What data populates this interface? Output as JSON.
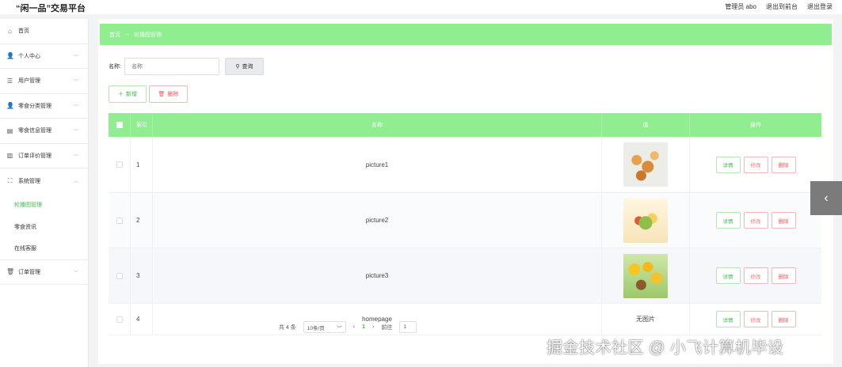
{
  "header": {
    "brand": "“闲一品”交易平台",
    "admin": "管理员 abo",
    "to_front": "退出到前台",
    "logout": "退出登录"
  },
  "sidebar": {
    "items": [
      {
        "label": "首页",
        "icon": "home-icon",
        "glyph": "⌂"
      },
      {
        "label": "个人中心",
        "icon": "user-icon",
        "glyph": "👤"
      },
      {
        "label": "用户管理",
        "icon": "list-icon",
        "glyph": "☰"
      },
      {
        "label": "零食分类管理",
        "icon": "person-icon",
        "glyph": "👤"
      },
      {
        "label": "零食信息管理",
        "icon": "folder-icon",
        "glyph": "▤"
      },
      {
        "label": "订单评价管理",
        "icon": "chart-icon",
        "glyph": "▥"
      },
      {
        "label": "系统管理",
        "icon": "expand-icon",
        "glyph": "⛶"
      }
    ],
    "sub_items": [
      "轮播图管理",
      "零食资讯",
      "在线客服"
    ],
    "last_item": {
      "label": "订单管理",
      "icon": "trash-icon",
      "glyph": "🗑"
    }
  },
  "breadcrumb": {
    "home": "首页",
    "arrow": "→",
    "current": "轮播图管理"
  },
  "search": {
    "label": "名称",
    "placeholder": "名称",
    "button": "查询"
  },
  "actions": {
    "add": "新增",
    "delete": "删除"
  },
  "table": {
    "columns": [
      "索引",
      "名称",
      "值",
      "操作"
    ],
    "rows": [
      {
        "index": "1",
        "name": "picture1",
        "image": "thumb1"
      },
      {
        "index": "2",
        "name": "picture2",
        "image": "thumb2"
      },
      {
        "index": "3",
        "name": "picture3",
        "image": "thumb3"
      },
      {
        "index": "4",
        "name": "homepage",
        "image_text": "无图片"
      }
    ],
    "op_detail": "详情",
    "op_edit": "修改",
    "op_delete": "删除"
  },
  "pager": {
    "total": "共 4 条",
    "page_size": "10条/页",
    "current": "1",
    "goto_label": "前往",
    "goto_value": "1"
  },
  "watermark": "掘金技术社区 @ 小飞计算机毕设",
  "colors": {
    "accent": "#90ee90",
    "text_green": "#3fb950",
    "danger": "#e55555"
  }
}
